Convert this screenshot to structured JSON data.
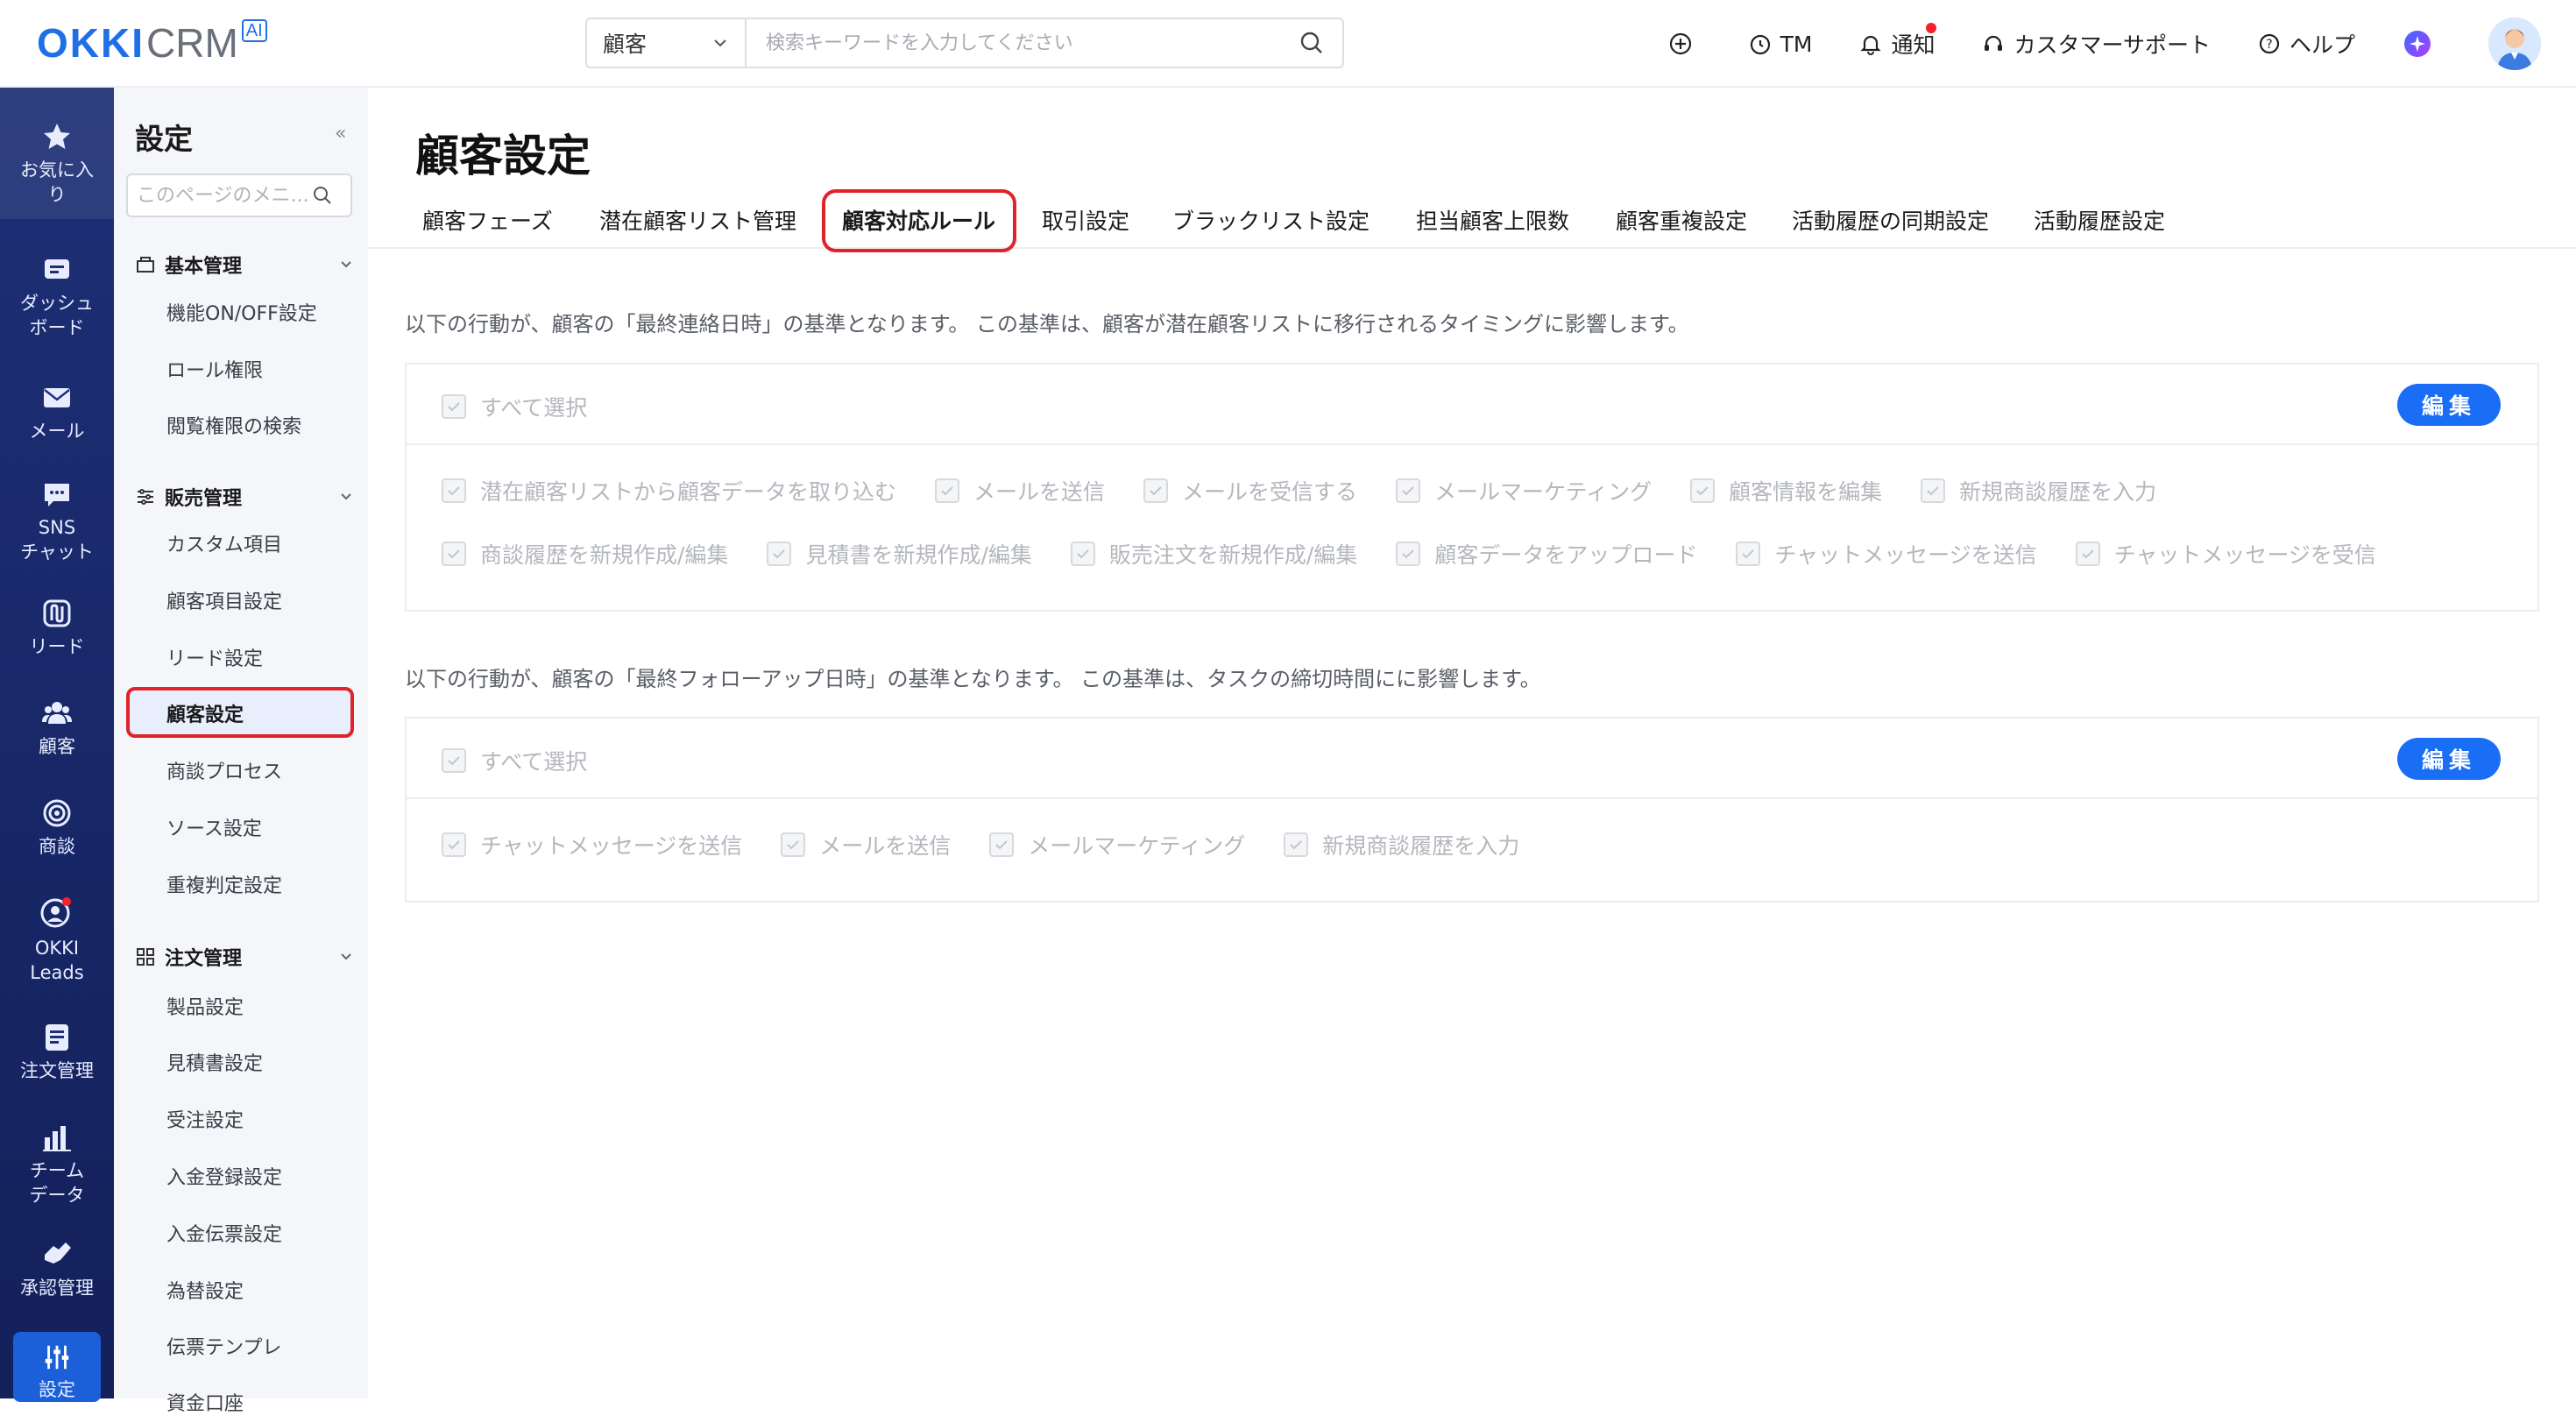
{
  "header": {
    "logo_main": "OKKI",
    "logo_crm": "CRM",
    "logo_badge": "AI",
    "search_type": "顧客",
    "search_placeholder": "検索キーワードを入力してください",
    "actions": {
      "tm": "TM",
      "notify": "通知",
      "support": "カスタマーサポート",
      "help": "ヘルプ"
    }
  },
  "leftnav": [
    {
      "icon": "star-icon",
      "label": "お気に入\nり"
    },
    {
      "icon": "dashboard-icon",
      "label": "ダッシュ\nボード"
    },
    {
      "icon": "mail-icon",
      "label": "メール"
    },
    {
      "icon": "chat-icon",
      "label": "SNS\nチャット"
    },
    {
      "icon": "lead-icon",
      "label": "リード"
    },
    {
      "icon": "customers-icon",
      "label": "顧客"
    },
    {
      "icon": "target-icon",
      "label": "商談"
    },
    {
      "icon": "okki-leads-icon",
      "label": "OKKI\nLeads"
    },
    {
      "icon": "order-icon",
      "label": "注文管理"
    },
    {
      "icon": "chart-icon",
      "label": "チーム\nデータ"
    },
    {
      "icon": "approval-icon",
      "label": "承認管理"
    },
    {
      "icon": "settings-icon",
      "label": "設定"
    }
  ],
  "sidebar": {
    "title": "設定",
    "search_placeholder": "このページのメニ...",
    "groups": [
      {
        "label": "基本管理",
        "items": [
          "機能ON/OFF設定",
          "ロール権限",
          "閲覧権限の検索"
        ]
      },
      {
        "label": "販売管理",
        "items": [
          "カスタム項目",
          "顧客項目設定",
          "リード設定",
          "顧客設定",
          "商談プロセス",
          "ソース設定",
          "重複判定設定"
        ]
      },
      {
        "label": "注文管理",
        "items": [
          "製品設定",
          "見積書設定",
          "受注設定",
          "入金登録設定",
          "入金伝票設定",
          "為替設定",
          "伝票テンプレ",
          "資金口座"
        ]
      }
    ],
    "active_item": "顧客設定"
  },
  "main": {
    "title": "顧客設定",
    "tabs": [
      "顧客フェーズ",
      "潜在顧客リスト管理",
      "顧客対応ルール",
      "取引設定",
      "ブラックリスト設定",
      "担当顧客上限数",
      "顧客重複設定",
      "活動履歴の同期設定",
      "活動履歴設定"
    ],
    "active_tab": "顧客対応ルール",
    "section1": {
      "desc": "以下の行動が、顧客の「最終連絡日時」の基準となります。 この基準は、顧客が潜在顧客リストに移行されるタイミングに影響します。",
      "select_all": "すべて選択",
      "edit": "編集",
      "row1": [
        "潜在顧客リストから顧客データを取り込む",
        "メールを送信",
        "メールを受信する",
        "メールマーケティング",
        "顧客情報を編集",
        "新規商談履歴を入力"
      ],
      "row2": [
        "商談履歴を新規作成/編集",
        "見積書を新規作成/編集",
        "販売注文を新規作成/編集",
        "顧客データをアップロード",
        "チャットメッセージを送信",
        "チャットメッセージを受信"
      ]
    },
    "section2": {
      "desc": "以下の行動が、顧客の「最終フォローアップ日時」の基準となります。 この基準は、タスクの締切時間にに影響します。",
      "select_all": "すべて選択",
      "edit": "編集",
      "row1": [
        "チャットメッセージを送信",
        "メールを送信",
        "メールマーケティング",
        "新規商談履歴を入力"
      ]
    }
  },
  "colors": {
    "brand": "#1f6fe8",
    "nav_bg": "#1d2f76",
    "nav_active": "#1b5fd9",
    "highlight": "#e0222b",
    "edit_button": "#1a6ef5"
  }
}
